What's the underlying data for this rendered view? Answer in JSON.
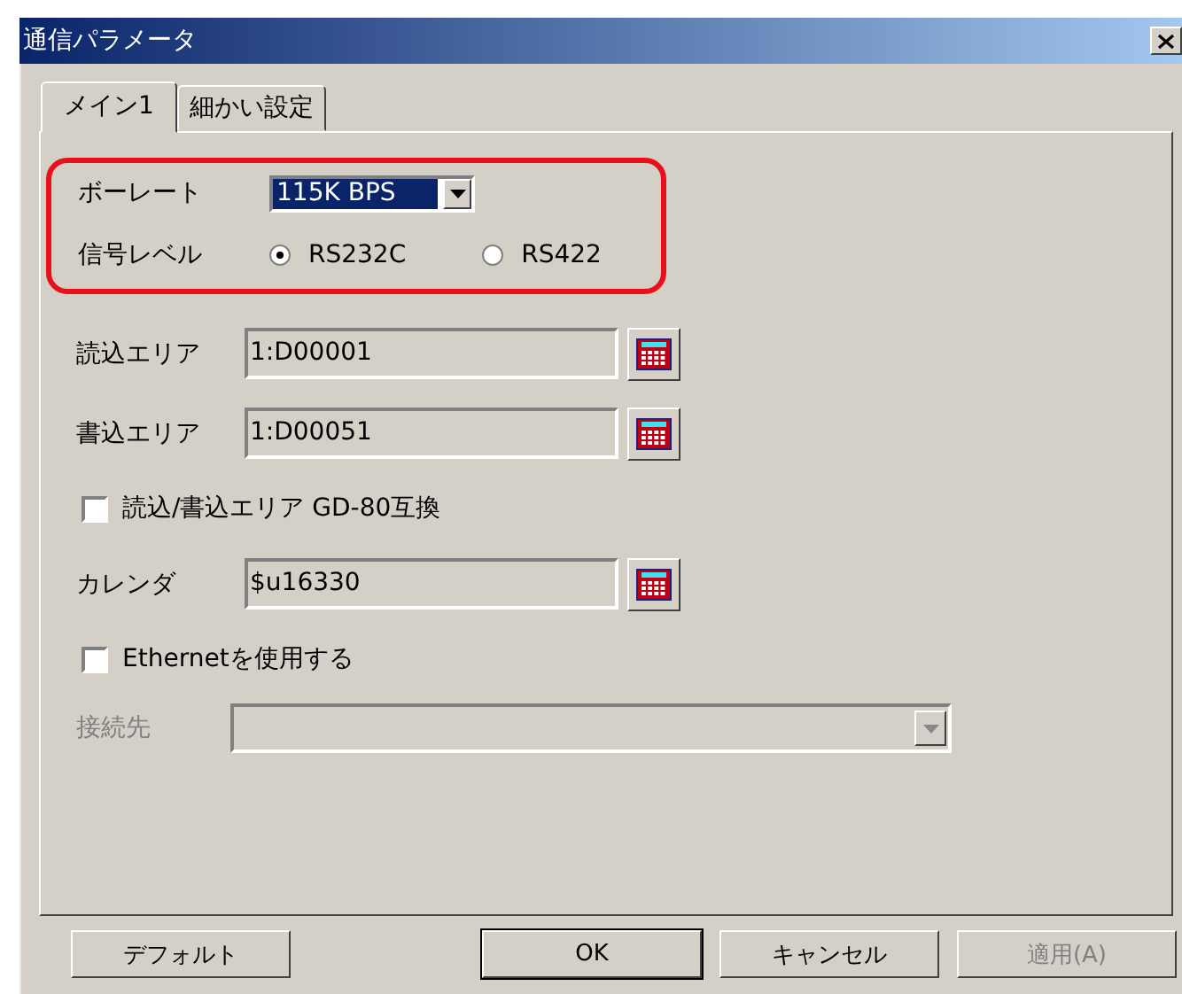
{
  "window": {
    "title": "通信パラメータ"
  },
  "tabs": [
    {
      "label": "メイン1",
      "selected": true
    },
    {
      "label": "細かい設定",
      "selected": false
    }
  ],
  "highlighted_rows": [
    {
      "kind": "combo",
      "label": "ボーレート",
      "value": "115K BPS",
      "selected": true
    },
    {
      "kind": "radio",
      "label": "信号レベル",
      "options": [
        {
          "label": "RS232C",
          "selected": true
        },
        {
          "label": "RS422",
          "selected": false
        }
      ]
    }
  ],
  "rows": [
    {
      "kind": "field",
      "label": "読込エリア",
      "value": "1:D00001"
    },
    {
      "kind": "field",
      "label": "書込エリア",
      "value": "1:D00051"
    },
    {
      "kind": "checkbox",
      "label": "読込/書込エリア GD-80互換",
      "checked": false
    },
    {
      "kind": "field",
      "label": "カレンダ",
      "value": "$u16330"
    },
    {
      "kind": "checkbox",
      "label": "Ethernetを使用する",
      "checked": false
    },
    {
      "kind": "combo",
      "label": "接続先",
      "disabled": true
    }
  ],
  "buttons": [
    {
      "label": "デフォルト",
      "default": false,
      "disabled": false
    },
    {
      "label": "OK",
      "default": true,
      "disabled": false
    },
    {
      "label": "キャンセル",
      "default": false,
      "disabled": false
    },
    {
      "label": "適用(A)",
      "default": false,
      "disabled": true
    }
  ]
}
